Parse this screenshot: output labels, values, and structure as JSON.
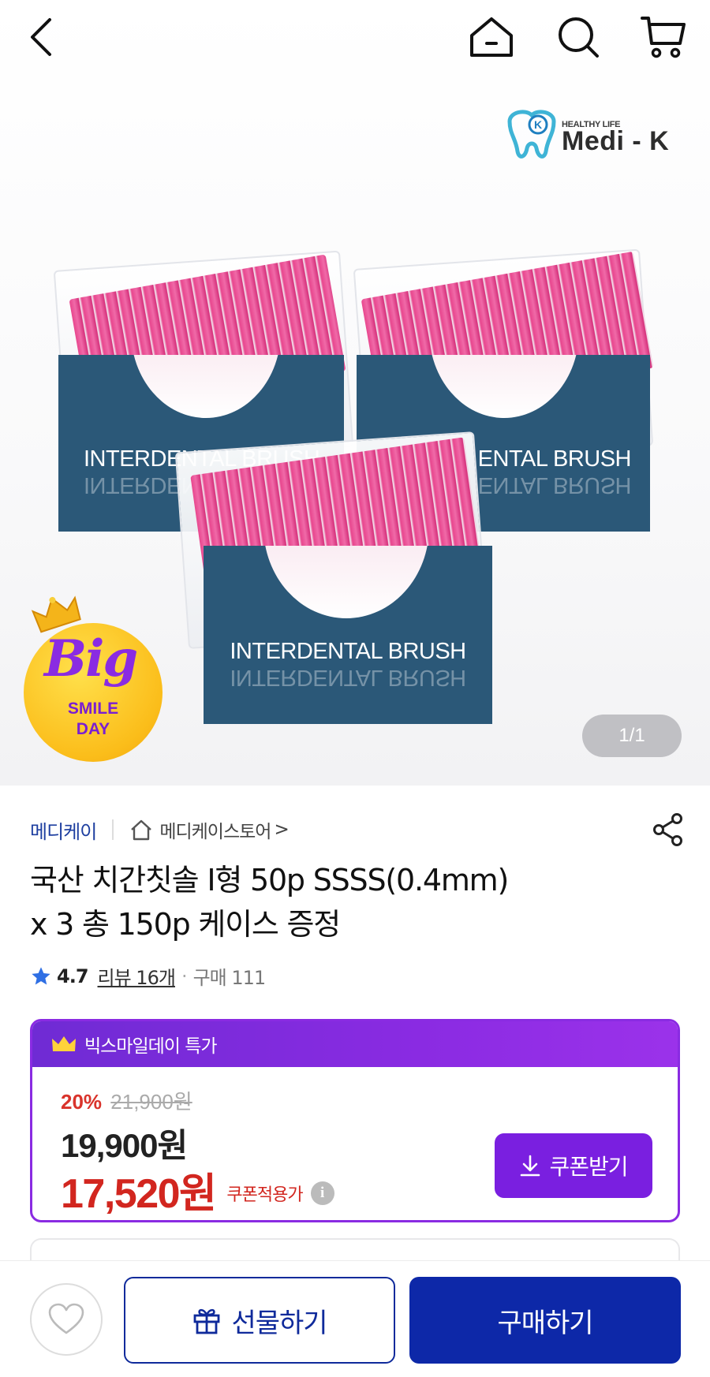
{
  "nav": {
    "back_icon": "chevron-left-icon",
    "home_icon": "home-icon",
    "search_icon": "search-icon",
    "cart_icon": "cart-icon"
  },
  "hero": {
    "logo_tagline": "HEALTHY LIFE",
    "logo_name": "Medi - K",
    "logo_mark": "K",
    "box_label": "INTERDENTAL BRUSH",
    "box_label_partial_left": "INTERDENTAL BRUSH",
    "box_label_partial_right": "ENTAL BRUSH",
    "badge_big": "Big",
    "badge_line1": "SMILE",
    "badge_line2": "DAY",
    "pager": "1/1"
  },
  "product": {
    "brand": "메디케이",
    "store": "메디케이스토어",
    "store_arrow": ">",
    "title_line1": "국산 치간칫솔 I형 50p SSSS(0.4mm)",
    "title_line2": "x 3 총 150p 케이스 증정",
    "rating": "4.7",
    "reviews": "리뷰 16개",
    "purchases": "구매 111"
  },
  "promo": {
    "header": "빅스마일데이 특가",
    "discount_pct": "20%",
    "original_price": "21,900원",
    "sale_price": "19,900원",
    "coupon_price": "17,520원",
    "coupon_note": "쿠폰적용가",
    "info_icon": "i",
    "coupon_button": "쿠폰받기"
  },
  "bottom": {
    "wish_icon": "heart-icon",
    "gift_button": "선물하기",
    "buy_button": "구매하기"
  },
  "colors": {
    "brand_blue": "#1e3fa0",
    "promo_purple": "#8a2be2",
    "price_red": "#d2261f",
    "buy_navy": "#0d28a8",
    "card_blue": "#2b5878",
    "brush_pink": "#e8468e"
  }
}
